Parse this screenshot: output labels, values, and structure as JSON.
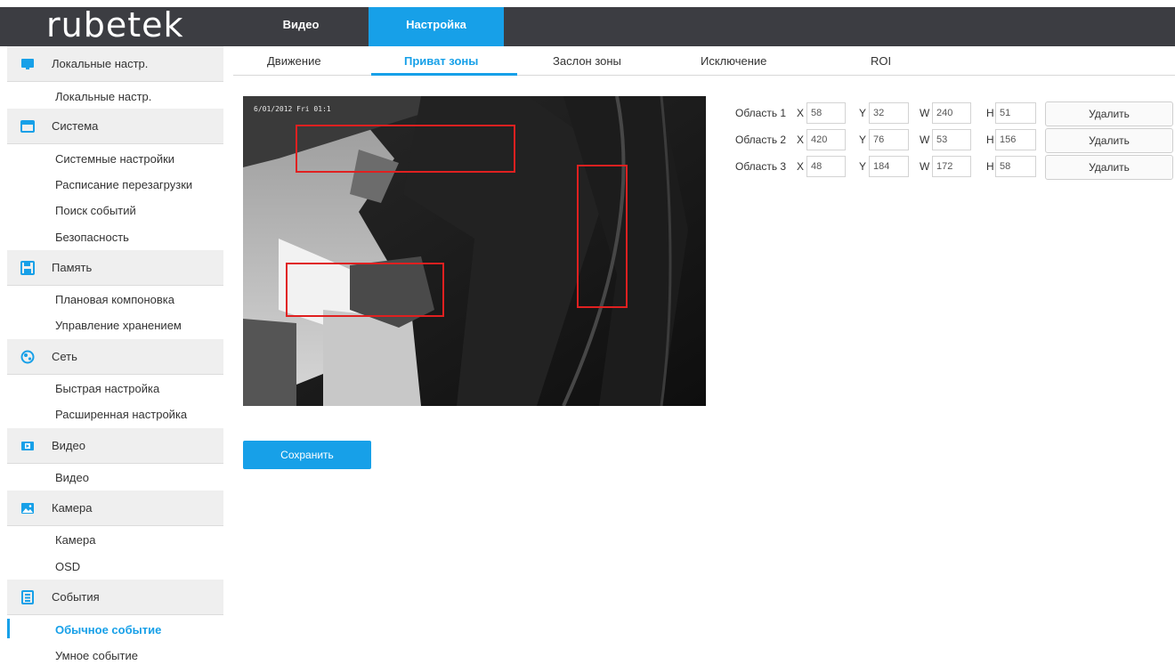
{
  "brand": {
    "logo_text": "rubetek"
  },
  "top_tabs": [
    {
      "label": "Видео"
    },
    {
      "label": "Настройка"
    }
  ],
  "sidebar": {
    "groups": [
      {
        "label": "Локальные настр.",
        "icon": "monitor-icon",
        "items": [
          "Локальные настр."
        ]
      },
      {
        "label": "Система",
        "icon": "system-icon",
        "items": [
          "Системные настройки",
          "Расписание перезагрузки",
          "Поиск событий",
          "Безопасность"
        ]
      },
      {
        "label": "Память",
        "icon": "floppy-icon",
        "items": [
          "Плановая компоновка",
          "Управление хранением"
        ]
      },
      {
        "label": "Сеть",
        "icon": "globe-icon",
        "items": [
          "Быстрая настройка",
          "Расширенная настройка"
        ]
      },
      {
        "label": "Видео",
        "icon": "video-icon",
        "items": [
          "Видео"
        ]
      },
      {
        "label": "Камера",
        "icon": "image-icon",
        "items": [
          "Камера",
          "OSD"
        ]
      },
      {
        "label": "События",
        "icon": "events-icon",
        "items": [
          "Обычное событие",
          "Умное событие"
        ]
      }
    ],
    "active_item": "Обычное событие"
  },
  "sub_tabs": [
    {
      "label": "Движение"
    },
    {
      "label": "Приват зоны"
    },
    {
      "label": "Заслон зоны"
    },
    {
      "label": "Исключение"
    },
    {
      "label": "ROI"
    }
  ],
  "active_sub_tab": "Приват зоны",
  "video": {
    "osd_timestamp": "6/01/2012 Fri 01:1"
  },
  "areas": [
    {
      "label": "Область 1",
      "x": "58",
      "y": "32",
      "w": "240",
      "h": "51",
      "delete_label": "Удалить"
    },
    {
      "label": "Область 2",
      "x": "420",
      "y": "76",
      "w": "53",
      "h": "156",
      "delete_label": "Удалить"
    },
    {
      "label": "Область 3",
      "x": "48",
      "y": "184",
      "w": "172",
      "h": "58",
      "delete_label": "Удалить"
    }
  ],
  "coord_letters": {
    "x": "X",
    "y": "Y",
    "w": "W",
    "h": "H"
  },
  "save_label": "Сохранить",
  "colors": {
    "accent": "#17a0e8",
    "topbar": "#3c3d42",
    "zone": "#e02020"
  }
}
